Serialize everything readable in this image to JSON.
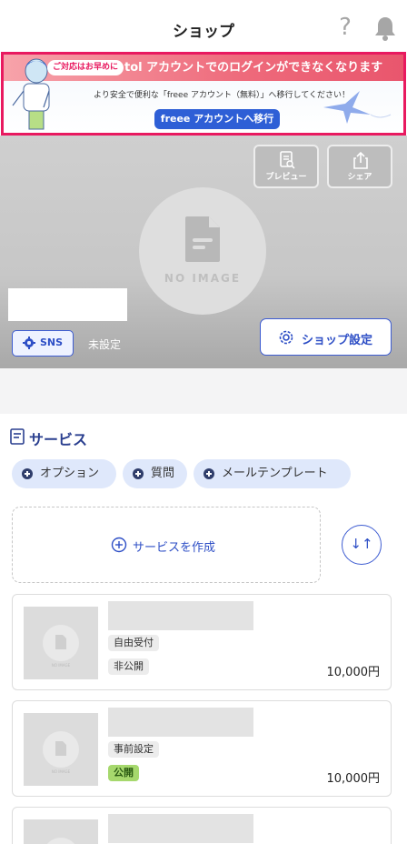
{
  "header": {
    "title": "ショップ",
    "help_glyph": "?"
  },
  "banner": {
    "pill": "ご対応はお早めに",
    "headline": "tol アカウントでのログインができなくなります",
    "subtext": "より安全で便利な「freee アカウント（無料）」へ移行してください！",
    "button_label": "freee アカウントへ移行",
    "border_color": "#e8195f"
  },
  "hero": {
    "preview_label": "プレビュー",
    "share_label": "シェア",
    "no_image": "NO IMAGE",
    "sns_label": "SNS",
    "sns_status": "未設定",
    "shop_settings_label": "ショップ設定"
  },
  "services": {
    "section_title": "サービス",
    "chips": [
      {
        "label": "オプション"
      },
      {
        "label": "質問"
      },
      {
        "label": "メールテンプレート"
      }
    ],
    "create_label": "サービスを作成",
    "sort_glyph": "↓↑",
    "no_image_small": "NO IMAGE",
    "cards": [
      {
        "tags": [
          "自由受付",
          "非公開"
        ],
        "price": "10,000円"
      },
      {
        "tags": [
          "事前設定",
          "公開"
        ],
        "price": "10,000円"
      }
    ]
  },
  "colors": {
    "accent": "#2e4fc6",
    "public_tag": "#a6d86d"
  }
}
